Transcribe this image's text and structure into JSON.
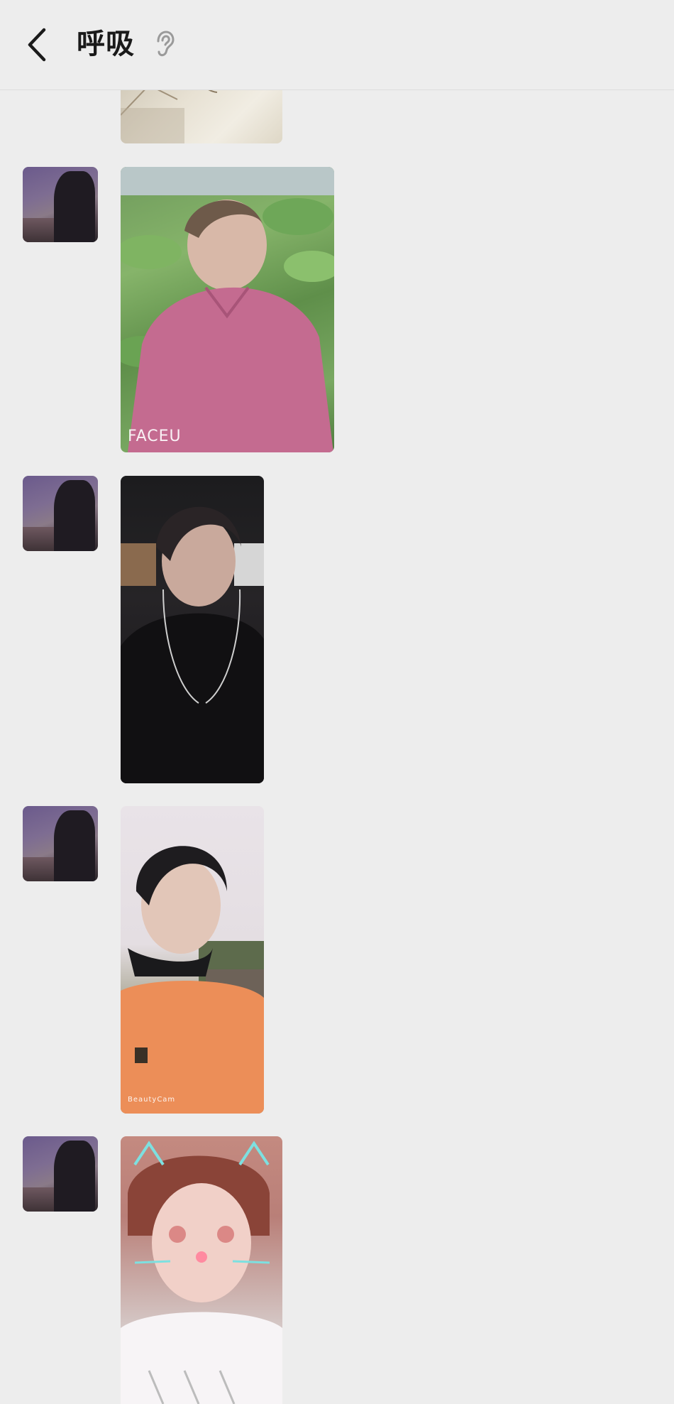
{
  "header": {
    "title": "呼吸",
    "back_icon": "chevron-left-icon",
    "voice_icon": "ear-icon"
  },
  "messages": [
    {
      "type": "image",
      "watermark": ""
    },
    {
      "type": "image",
      "watermark": "FACEU"
    },
    {
      "type": "image",
      "watermark": ""
    },
    {
      "type": "image",
      "watermark": "BeautyCam"
    },
    {
      "type": "image",
      "watermark": ""
    }
  ],
  "colors": {
    "background": "#ededed",
    "title": "#1a1a1a"
  }
}
